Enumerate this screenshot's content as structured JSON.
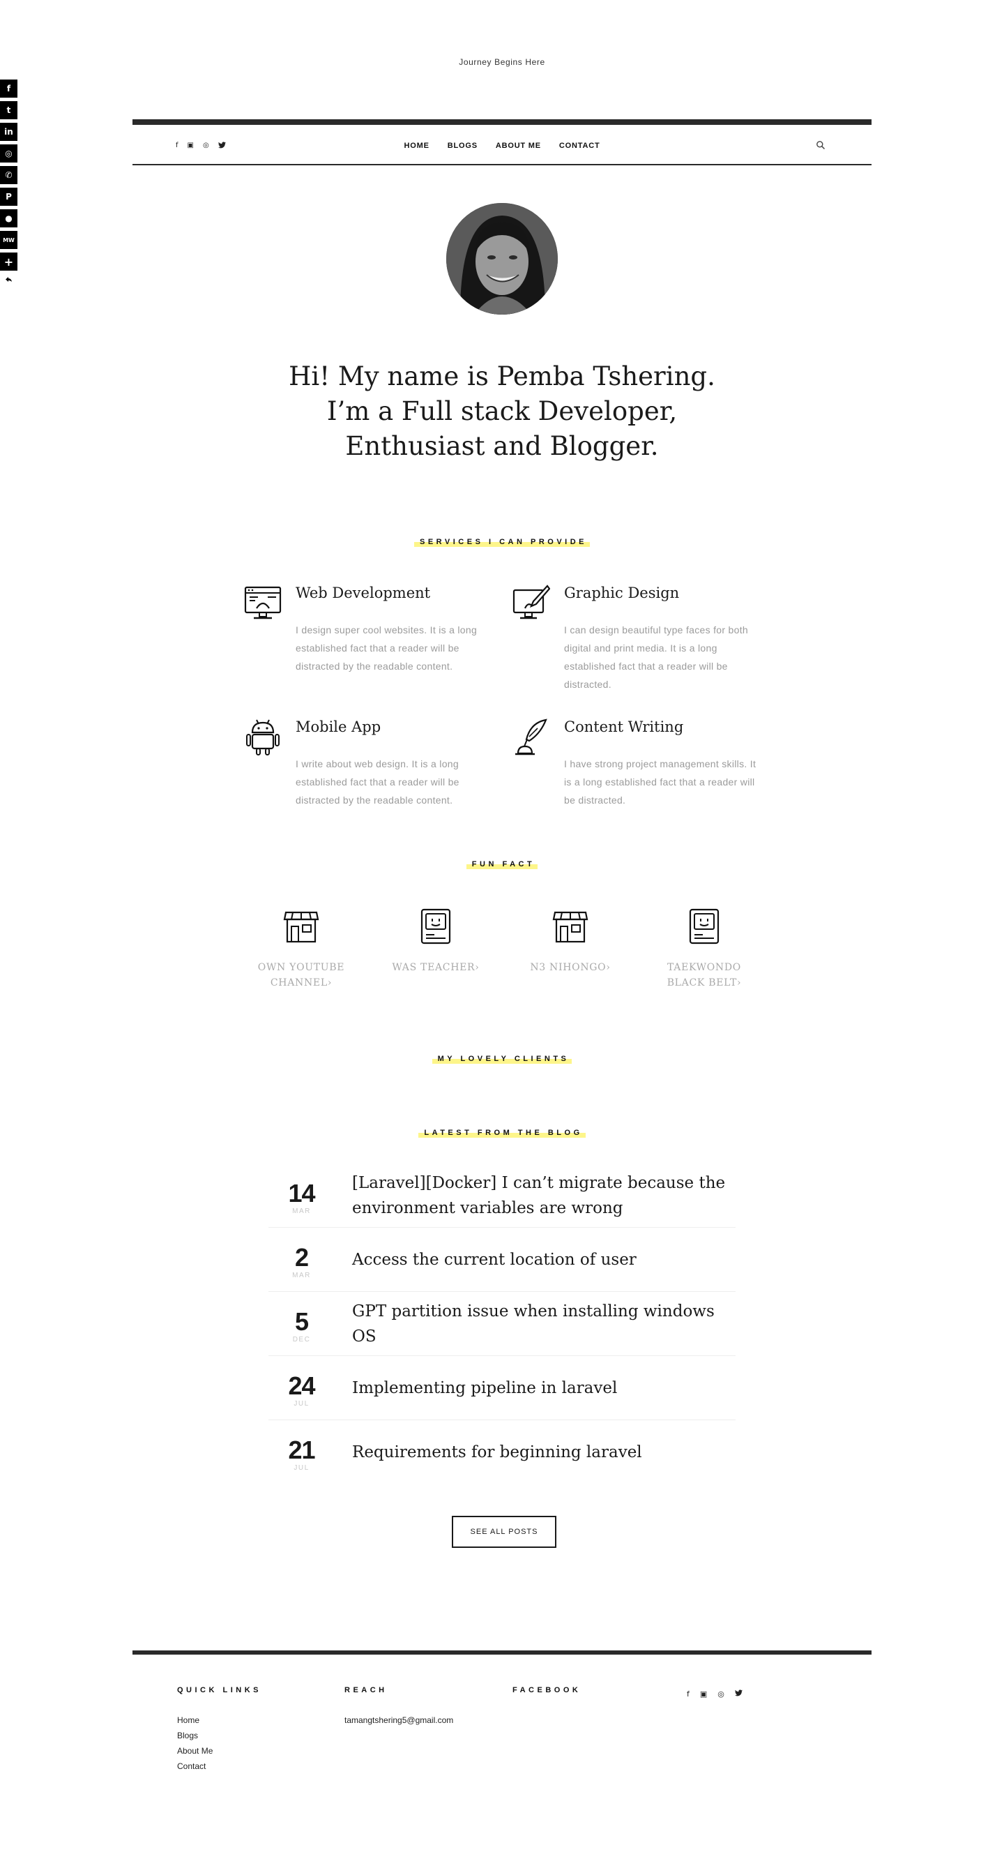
{
  "tagline": "Journey Begins Here",
  "share_bar": {
    "buttons": [
      {
        "icon": "facebook-icon",
        "glyph": "f"
      },
      {
        "icon": "twitter-icon",
        "glyph": "t"
      },
      {
        "icon": "linkedin-icon",
        "glyph": "in"
      },
      {
        "icon": "instagram-icon",
        "glyph": "◎"
      },
      {
        "icon": "whatsapp-icon",
        "glyph": "✆"
      },
      {
        "icon": "pinterest-icon",
        "glyph": "P"
      },
      {
        "icon": "reddit-icon",
        "glyph": "●"
      },
      {
        "icon": "mewe-icon",
        "glyph": "MW"
      },
      {
        "icon": "more-icon",
        "glyph": "+"
      }
    ],
    "hide_icon": "hide-arrow-icon"
  },
  "nav": {
    "social": [
      {
        "icon": "facebook-icon",
        "glyph": "f"
      },
      {
        "icon": "linkedin-icon",
        "glyph": "▣"
      },
      {
        "icon": "instagram-icon",
        "glyph": "◎"
      },
      {
        "icon": "twitter-icon",
        "glyph": "♥"
      }
    ],
    "menu": [
      "HOME",
      "BLOGS",
      "ABOUT ME",
      "CONTACT"
    ],
    "search_icon": "search-icon"
  },
  "hero": {
    "line1": "Hi! My name is Pemba Tshering.",
    "line2": "I’m a Full stack Developer,",
    "line3": "Enthusiast and Blogger."
  },
  "services": {
    "label": "SERVICES I CAN PROVIDE",
    "items": [
      {
        "title": "Web Development",
        "text": "I design super cool websites. It is a long established fact that a reader will be distracted by the readable content.",
        "icon": "web-development-icon"
      },
      {
        "title": "Graphic Design",
        "text": "I can design beautiful type faces for both digital and print media. It is a long established fact that a reader will be distracted.",
        "icon": "graphic-design-icon"
      },
      {
        "title": "Mobile App",
        "text": "I write about web design. It is a long established fact that a reader will be distracted by the readable content.",
        "icon": "android-icon"
      },
      {
        "title": "Content Writing",
        "text": "I have strong project management skills. It is a long established fact that a reader will be distracted.",
        "icon": "quill-icon"
      }
    ]
  },
  "fun_fact": {
    "label": "FUN FACT",
    "items": [
      {
        "line1": "OWN YOUTUBE",
        "line2": "CHANNEL›",
        "icon": "shop-icon"
      },
      {
        "line1": "WAS TEACHER›",
        "line2": "",
        "icon": "computer-icon"
      },
      {
        "line1": "N3 NIHONGO›",
        "line2": "",
        "icon": "shop-icon"
      },
      {
        "line1": "TAEKWONDO",
        "line2": "BLACK BELT›",
        "icon": "computer-icon"
      }
    ]
  },
  "clients": {
    "label": "MY LOVELY CLIENTS"
  },
  "blog": {
    "label": "LATEST FROM THE BLOG",
    "posts": [
      {
        "day": "14",
        "month": "MAR",
        "title": "[Laravel][Docker] I can’t migrate because the environment variables are wrong"
      },
      {
        "day": "2",
        "month": "MAR",
        "title": "Access the current location of user"
      },
      {
        "day": "5",
        "month": "DEC",
        "title": "GPT partition issue when installing windows OS"
      },
      {
        "day": "24",
        "month": "JUL",
        "title": "Implementing pipeline in laravel"
      },
      {
        "day": "21",
        "month": "JUL",
        "title": "Requirements for beginning laravel"
      }
    ],
    "see_all": "SEE ALL POSTS"
  },
  "footer": {
    "quick_links": {
      "title": "QUICK LINKS",
      "links": [
        "Home",
        "Blogs",
        "About Me",
        "Contact"
      ]
    },
    "reach": {
      "title": "REACH",
      "email": "tamangtshering5@gmail.com"
    },
    "facebook": {
      "title": "FACEBOOK"
    },
    "social": [
      {
        "icon": "facebook-icon",
        "glyph": "f"
      },
      {
        "icon": "linkedin-icon",
        "glyph": "▣"
      },
      {
        "icon": "instagram-icon",
        "glyph": "◎"
      },
      {
        "icon": "twitter-icon",
        "glyph": "♥"
      }
    ]
  }
}
